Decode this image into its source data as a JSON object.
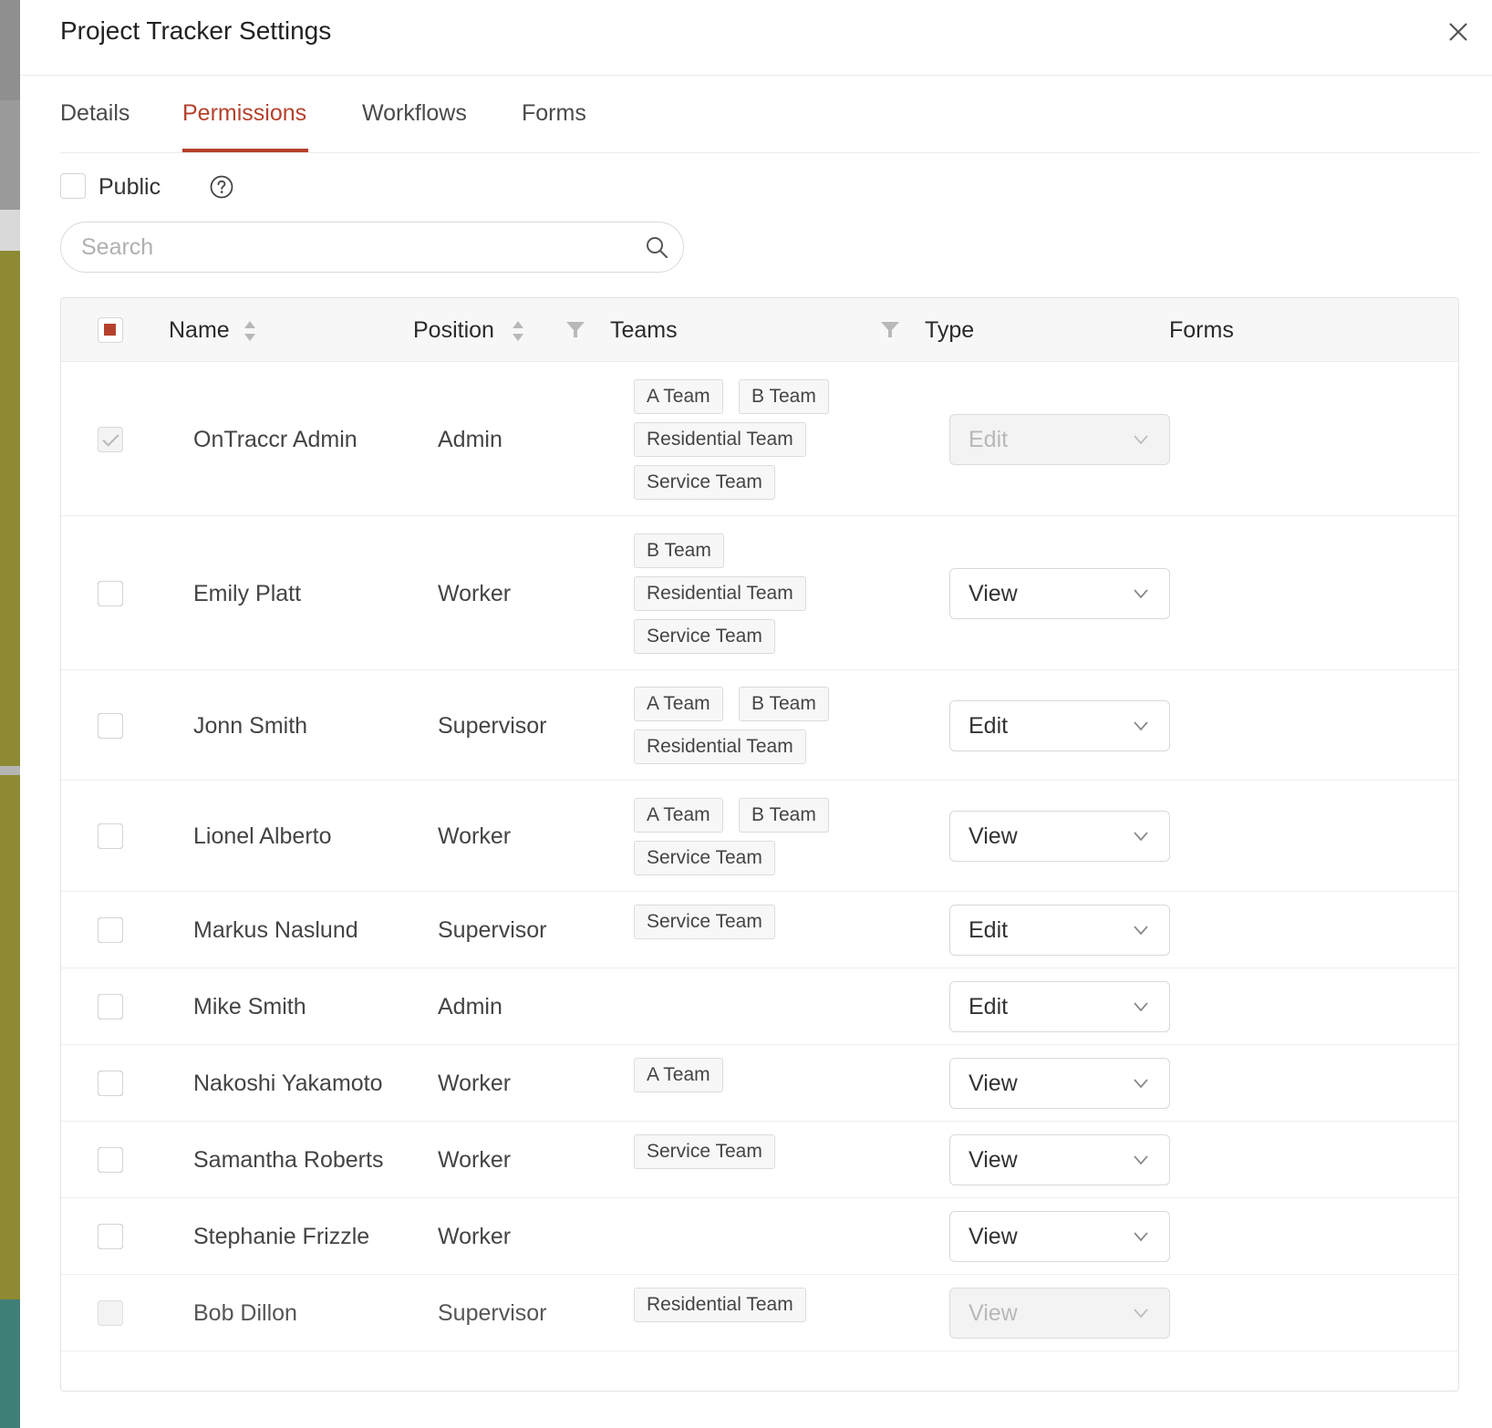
{
  "modal": {
    "title": "Project Tracker Settings"
  },
  "tabs": [
    {
      "label": "Details"
    },
    {
      "label": "Permissions",
      "active": true
    },
    {
      "label": "Workflows"
    },
    {
      "label": "Forms"
    }
  ],
  "public": {
    "label": "Public",
    "checked": false
  },
  "search": {
    "placeholder": "Search",
    "value": ""
  },
  "table": {
    "headers": {
      "name": "Name",
      "position": "Position",
      "teams": "Teams",
      "type": "Type",
      "forms": "Forms"
    },
    "rows": [
      {
        "name": "OnTraccr Admin",
        "position": "Admin",
        "teams": [
          "A Team",
          "B Team",
          "Residential Team",
          "Service Team"
        ],
        "type": "Edit",
        "selected": true,
        "locked": true,
        "forms": true
      },
      {
        "name": "Emily Platt",
        "position": "Worker",
        "teams": [
          "B Team",
          "Residential Team",
          "Service Team"
        ],
        "type": "View",
        "selected": true,
        "forms": false
      },
      {
        "name": "Jonn Smith",
        "position": "Supervisor",
        "teams": [
          "A Team",
          "B Team",
          "Residential Team"
        ],
        "type": "Edit",
        "selected": true,
        "forms": false
      },
      {
        "name": "Lionel Alberto",
        "position": "Worker",
        "teams": [
          "A Team",
          "B Team",
          "Service Team"
        ],
        "type": "View",
        "selected": true,
        "forms": false
      },
      {
        "name": "Markus Naslund",
        "position": "Supervisor",
        "teams": [
          "Service Team"
        ],
        "type": "Edit",
        "selected": true,
        "forms": false
      },
      {
        "name": "Mike Smith",
        "position": "Admin",
        "teams": [],
        "type": "Edit",
        "selected": true,
        "forms": false
      },
      {
        "name": "Nakoshi Yakamoto",
        "position": "Worker",
        "teams": [
          "A Team"
        ],
        "type": "View",
        "selected": true,
        "forms": false
      },
      {
        "name": "Samantha Roberts",
        "position": "Worker",
        "teams": [
          "Service Team"
        ],
        "type": "View",
        "selected": true,
        "forms": false
      },
      {
        "name": "Stephanie Frizzle",
        "position": "Worker",
        "teams": [],
        "type": "View",
        "selected": true,
        "forms": false
      },
      {
        "name": "Bob Dillon",
        "position": "Supervisor",
        "teams": [
          "Residential Team"
        ],
        "type": "View",
        "selected": false,
        "disabled": true,
        "forms": false
      }
    ]
  },
  "icons": {
    "close": "close-icon",
    "help": "question-circle-icon",
    "search": "search-icon",
    "sort": "sort-icon",
    "filter": "filter-icon",
    "chevron": "chevron-down-icon"
  },
  "colors": {
    "accent": "#b5412c",
    "border": "#d9d9d9",
    "tag_bg": "#f7f7f7"
  }
}
